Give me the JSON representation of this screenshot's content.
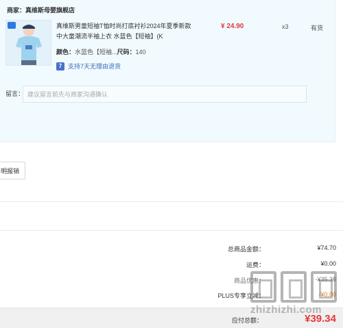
{
  "shop": {
    "label": "商家：",
    "name": "真维斯母婴旗舰店"
  },
  "product": {
    "title": "真维斯男童短袖T恤时尚打底衬衫2024年夏季新款中大童潮流半袖上衣 水蓝色【短袖】(K",
    "price": "¥ 24.90",
    "qty": "x3",
    "stock": "有货",
    "color_key": "颜色：",
    "color_val": "水蓝色【短袖...",
    "size_key": "尺码：",
    "size_val": "140",
    "return_icon": "7",
    "return_text": "支持7天无理由退货"
  },
  "message": {
    "label": "留言：",
    "placeholder": "建议留言前先与商家沟通确认"
  },
  "invoice": {
    "label": "明报销"
  },
  "summary": {
    "goods_label": "总商品金额：",
    "goods_val": "¥74.70",
    "shipping_label": "运费：",
    "shipping_val": "¥0.00",
    "discount_label": "商品优惠：",
    "discount_val": "-¥35.36",
    "plus_label": "PLUS专享立减：",
    "plus_val": "-¥0.00",
    "total_label": "应付总额：",
    "total_val": "¥39.34"
  },
  "watermark": {
    "text": "zhizhizhi.com"
  },
  "colors": {
    "panel_bg": "#f1fafe",
    "price_red": "#e4393c",
    "link_blue": "#3b6fb6"
  }
}
